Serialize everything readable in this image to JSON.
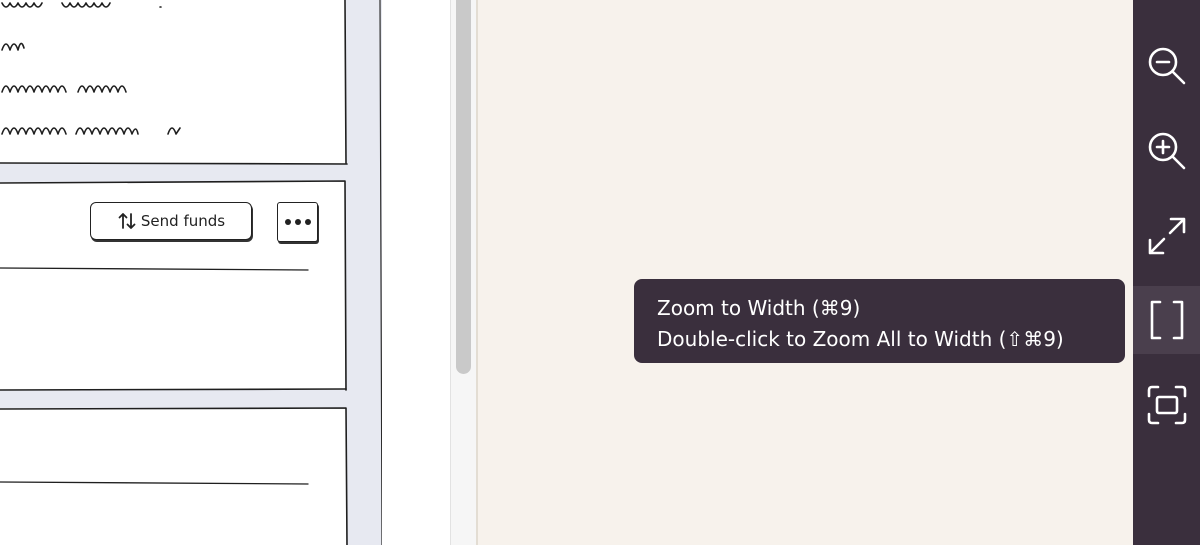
{
  "left_panel": {
    "actions": {
      "send_funds_label": "Send funds",
      "send_funds_icon": "arrows-up-down-icon",
      "more_icon": "ellipsis-icon"
    }
  },
  "tooltip": {
    "line1": "Zoom to Width (⌘9)",
    "line2": "Double-click to Zoom All to Width (⇧⌘9)"
  },
  "toolbar": {
    "buttons": [
      {
        "name": "zoom-out",
        "icon": "zoom-out-icon"
      },
      {
        "name": "zoom-in",
        "icon": "zoom-in-icon"
      },
      {
        "name": "expand",
        "icon": "expand-icon"
      },
      {
        "name": "zoom-to-width",
        "icon": "brackets-icon",
        "active": true
      },
      {
        "name": "fit-frame",
        "icon": "frame-icon"
      }
    ]
  },
  "colors": {
    "toolbar_bg": "#3a2f3d",
    "tooltip_bg": "#3a2f3d",
    "canvas_bg": "#f7f2ec",
    "sketch_panel_bg": "#e7e9f1"
  }
}
